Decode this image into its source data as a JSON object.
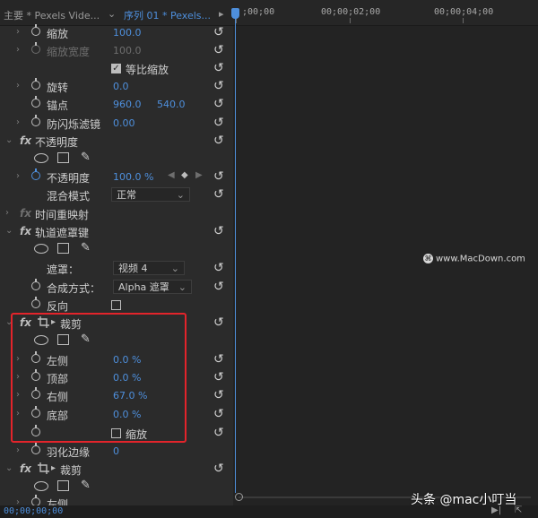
{
  "tabs": {
    "source": "主要 * Pexels Vide...",
    "sequence": "序列 01 * Pexels..."
  },
  "timeline": {
    "tc0": ";00;00",
    "tc2": "00;00;02;00",
    "tc4": "00;00;04;00",
    "current_timecode": "00;00;00;00"
  },
  "motion": {
    "scale": {
      "label": "缩放",
      "value": "100.0"
    },
    "scale_width": {
      "label": "缩放宽度",
      "value": "100.0"
    },
    "uniform_scale": {
      "label": "等比缩放"
    },
    "rotation": {
      "label": "旋转",
      "value": "0.0"
    },
    "anchor": {
      "label": "锚点",
      "x": "960.0",
      "y": "540.0"
    },
    "antiflicker": {
      "label": "防闪烁滤镜",
      "value": "0.00"
    }
  },
  "opacity": {
    "title": "不透明度",
    "opacity": {
      "label": "不透明度",
      "value": "100.0 %"
    },
    "blend": {
      "label": "混合模式",
      "value": "正常"
    }
  },
  "time_remap": {
    "title": "时间重映射"
  },
  "track_matte": {
    "title": "轨道遮罩键",
    "matte": {
      "label": "遮罩：",
      "value": "视频 4"
    },
    "composite": {
      "label": "合成方式：",
      "value": "Alpha 遮罩"
    },
    "reverse": {
      "label": "反向"
    }
  },
  "crop": {
    "title": "裁剪",
    "left": {
      "label": "左侧",
      "value": "0.0 %"
    },
    "top": {
      "label": "顶部",
      "value": "0.0 %"
    },
    "right": {
      "label": "右侧",
      "value": "67.0 %"
    },
    "bottom": {
      "label": "底部",
      "value": "0.0 %"
    },
    "zoom": {
      "label": "缩放"
    },
    "feather": {
      "label": "羽化边缘",
      "value": "0"
    }
  },
  "crop2": {
    "title": "裁剪",
    "left": {
      "label": "左侧"
    }
  },
  "watermarks": {
    "site": "www.MacDown.com",
    "author": "头条 @mac小叮当"
  },
  "colors": {
    "accent": "#4e8fdc",
    "highlight": "#e3242b"
  }
}
